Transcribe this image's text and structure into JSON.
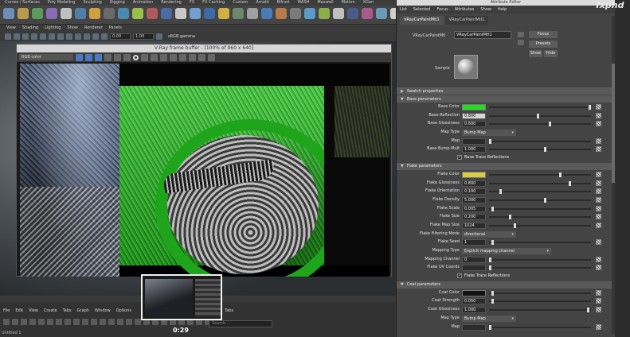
{
  "maya": {
    "menubar": [
      "Curves / Surfaces",
      "Poly Modeling",
      "Sculpting",
      "Rigging",
      "Animation",
      "Rendering",
      "FX",
      "FX Caching",
      "Custom",
      "Arnold",
      "Bifrost",
      "MASH",
      "Maxwell",
      "Motion",
      "XGen"
    ],
    "panel_menu": [
      "View",
      "Shading",
      "Lighting",
      "Show",
      "Renderer",
      "Panels"
    ],
    "toolbar_fields": {
      "value_a": "0.00",
      "value_b": "1.00",
      "color_space": "sRGB gamma"
    }
  },
  "vfb": {
    "title": "V-Ray frame buffer - [100% of 960 x 640]",
    "channel": "RGB color"
  },
  "thumbnail": {
    "time": "0:29"
  },
  "bottom": {
    "menu_left": [
      "File",
      "Edit",
      "View",
      "Create",
      "Tabs",
      "Graph",
      "Window",
      "Options"
    ],
    "menu_right": [
      "Tabs"
    ],
    "search_placeholder": "Search...",
    "tab_label": "Untitled 1"
  },
  "attribute_editor": {
    "title": "Attribute Editor",
    "menu": [
      "List",
      "Selected",
      "Focus",
      "Attributes",
      "Show",
      "Help"
    ],
    "tabs": [
      "VRayCarPaintMtl1",
      "VRayCarPaintMtl1"
    ],
    "name_label": "VRayCarPaintMtl",
    "name_value": "VRayCarPaintMtl1",
    "buttons": {
      "focus": "Focus",
      "presets": "Presets",
      "show": "Show",
      "hide": "Hide"
    },
    "sample_label": "Sample",
    "sections": {
      "swatch": "Swatch properties",
      "base": "Base parameters",
      "flake": "Flake parameters",
      "coat": "Coat parameters"
    },
    "base_rows": [
      {
        "label": "Base Color",
        "type": "color",
        "color": "#22dd22",
        "slider": 1.0
      },
      {
        "label": "Base Reflection",
        "type": "field",
        "value": "0.800",
        "highlight": true,
        "slider": 0.48
      },
      {
        "label": "Base Glossiness",
        "type": "field",
        "value": "0.600",
        "slider": 0.6
      },
      {
        "label": "Map Type",
        "type": "combo",
        "value": "Bump Map"
      },
      {
        "label": "Map",
        "type": "field",
        "value": "",
        "slider": 0.0
      },
      {
        "label": "Base Bump Mult",
        "type": "field",
        "value": "1.000",
        "slider": 0.55
      },
      {
        "label": "",
        "type": "check",
        "value": "Base Trace Reflections",
        "checked": true
      }
    ],
    "flake_rows": [
      {
        "label": "Flake Color",
        "type": "color",
        "color": "#d8cc45",
        "slider": 0.7
      },
      {
        "label": "Flake Glossiness",
        "type": "field",
        "value": "0.800",
        "slider": 0.8
      },
      {
        "label": "Flake Orientation",
        "type": "field",
        "value": "0.100",
        "slider": 0.1
      },
      {
        "label": "Flake Density",
        "type": "field",
        "value": "5.000",
        "slider": 0.55
      },
      {
        "label": "Flake Scale",
        "type": "field",
        "value": "0.005",
        "slider": 0.02
      },
      {
        "label": "Flake Size",
        "type": "field",
        "value": "0.200",
        "slider": 0.2
      },
      {
        "label": "Flake Map Size",
        "type": "field",
        "value": "1024",
        "slider": 0.25
      },
      {
        "label": "Flake Filtering Mode",
        "type": "combo",
        "value": "directional"
      },
      {
        "label": "Flake Seed",
        "type": "field",
        "value": "1",
        "slider": 0.02
      },
      {
        "label": "Mapping Type",
        "type": "combo",
        "value": "Explicit mapping channel",
        "wide": true
      },
      {
        "label": "Mapping Channel",
        "type": "field",
        "value": "0",
        "slider": 0.0
      },
      {
        "label": "Flake UV Coords",
        "type": "field",
        "value": "",
        "slider": 0.0,
        "map_checker": false
      },
      {
        "label": "",
        "type": "check",
        "value": "Flake Trace Reflections",
        "checked": true
      }
    ],
    "coat_rows": [
      {
        "label": "Coat Color",
        "type": "color",
        "color": "#111111",
        "slider": 0.02
      },
      {
        "label": "Coat Strength",
        "type": "field",
        "value": "0.050",
        "slider": 0.02
      },
      {
        "label": "Coat Glossiness",
        "type": "field",
        "value": "1.000",
        "slider": 0.98
      },
      {
        "label": "Map Type",
        "type": "combo",
        "value": "Bump Map"
      },
      {
        "label": "Map",
        "type": "field",
        "value": "",
        "slider": 0.0
      }
    ]
  },
  "watermark": "fxphd"
}
